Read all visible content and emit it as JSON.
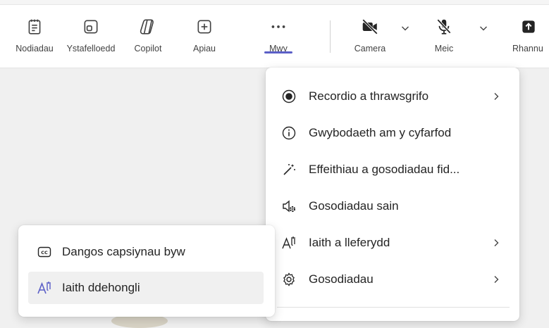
{
  "toolbar": {
    "items": [
      {
        "label": "Nodiadau",
        "icon": "notes-icon"
      },
      {
        "label": "Ystafelloedd",
        "icon": "rooms-icon"
      },
      {
        "label": "Copilot",
        "icon": "copilot-icon"
      },
      {
        "label": "Apiau",
        "icon": "add-apps-icon"
      },
      {
        "label": "Mwy",
        "icon": "more-icon",
        "selected": true
      },
      {
        "label": "Camera",
        "icon": "camera-off-icon"
      },
      {
        "label": "Meic",
        "icon": "mic-off-icon"
      },
      {
        "label": "Rhannu",
        "icon": "share-icon"
      }
    ]
  },
  "more_menu": {
    "items": [
      {
        "label": "Recordio a thrawsgrifo",
        "icon": "record-icon",
        "submenu": true
      },
      {
        "label": "Gwybodaeth am y cyfarfod",
        "icon": "info-icon",
        "submenu": false
      },
      {
        "label": "Effeithiau a gosodiadau fid...",
        "icon": "effects-wand-icon",
        "submenu": false
      },
      {
        "label": "Gosodiadau sain",
        "icon": "audio-settings-icon",
        "submenu": false
      },
      {
        "label": "Iaith a lleferydd",
        "icon": "language-icon",
        "submenu": true
      },
      {
        "label": "Gosodiadau",
        "icon": "gear-icon",
        "submenu": true
      }
    ]
  },
  "language_submenu": {
    "items": [
      {
        "label": "Dangos capsiynau byw",
        "icon": "closed-captions-icon",
        "active": false
      },
      {
        "label": "Iaith ddehongli",
        "icon": "interpretation-icon",
        "active": true
      }
    ]
  },
  "colors": {
    "accent": "#5b5fc7",
    "menu_bg": "#ffffff",
    "stage_bg": "#f0f0f0",
    "text": "#242424"
  }
}
